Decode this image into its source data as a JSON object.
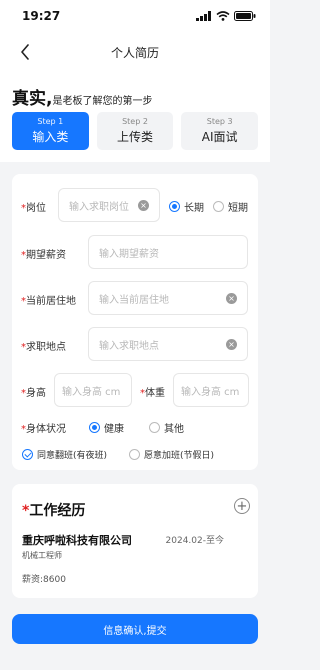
{
  "status_bar": {
    "time": "19:27"
  },
  "nav": {
    "title": "个人简历"
  },
  "slogan": {
    "strong": "真实,",
    "rest": "是老板了解您的第一步"
  },
  "steps": [
    {
      "number": "Step 1",
      "label": "输入类",
      "active": true
    },
    {
      "number": "Step 2",
      "label": "上传类",
      "active": false
    },
    {
      "number": "Step 3",
      "label": "AI面试",
      "active": false
    }
  ],
  "form": {
    "required_mark": "*",
    "position": {
      "label": "岗位",
      "placeholder": "输入求职岗位",
      "options": [
        "长期",
        "短期"
      ],
      "selected": "长期"
    },
    "salary": {
      "label": "期望薪资",
      "placeholder": "输入期望薪资"
    },
    "residence": {
      "label": "当前居住地",
      "placeholder": "输入当前居住地"
    },
    "location": {
      "label": "求职地点",
      "placeholder": "输入求职地点"
    },
    "height": {
      "label": "身高",
      "placeholder": "输入身高 cm"
    },
    "weight": {
      "label": "体重",
      "placeholder": "输入身高 cm"
    },
    "health": {
      "label": "身体状况",
      "options": [
        "健康",
        "其他"
      ],
      "selected": "健康"
    },
    "night_shift": {
      "label": "同意翻班(有夜班)",
      "checked": true
    },
    "overtime": {
      "label": "愿意加班(节假日)",
      "checked": false
    }
  },
  "work": {
    "required_mark": "*",
    "title": "工作经历",
    "add_symbol": "+",
    "company": "重庆呼啦科技有限公司",
    "period": "2024.02-至今",
    "job_title": "机械工程师",
    "salary": "薪资:8600"
  },
  "submit": {
    "label": "信息确认,提交"
  },
  "colors": {
    "accent": "#1677ff",
    "required": "#e02020",
    "background": "#f3f4f6"
  },
  "icons": [
    "back-arrow-icon",
    "signal-icon",
    "wifi-icon",
    "battery-icon",
    "clear-icon",
    "add-circle-icon"
  ]
}
